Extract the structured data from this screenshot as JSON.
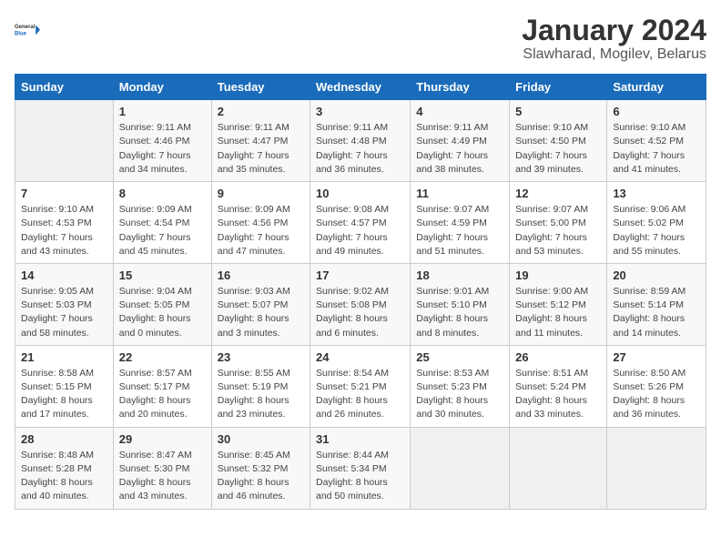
{
  "header": {
    "logo_line1": "General",
    "logo_line2": "Blue",
    "month": "January 2024",
    "location": "Slawharad, Mogilev, Belarus"
  },
  "days_of_week": [
    "Sunday",
    "Monday",
    "Tuesday",
    "Wednesday",
    "Thursday",
    "Friday",
    "Saturday"
  ],
  "weeks": [
    [
      {
        "num": "",
        "info": ""
      },
      {
        "num": "1",
        "info": "Sunrise: 9:11 AM\nSunset: 4:46 PM\nDaylight: 7 hours\nand 34 minutes."
      },
      {
        "num": "2",
        "info": "Sunrise: 9:11 AM\nSunset: 4:47 PM\nDaylight: 7 hours\nand 35 minutes."
      },
      {
        "num": "3",
        "info": "Sunrise: 9:11 AM\nSunset: 4:48 PM\nDaylight: 7 hours\nand 36 minutes."
      },
      {
        "num": "4",
        "info": "Sunrise: 9:11 AM\nSunset: 4:49 PM\nDaylight: 7 hours\nand 38 minutes."
      },
      {
        "num": "5",
        "info": "Sunrise: 9:10 AM\nSunset: 4:50 PM\nDaylight: 7 hours\nand 39 minutes."
      },
      {
        "num": "6",
        "info": "Sunrise: 9:10 AM\nSunset: 4:52 PM\nDaylight: 7 hours\nand 41 minutes."
      }
    ],
    [
      {
        "num": "7",
        "info": "Sunrise: 9:10 AM\nSunset: 4:53 PM\nDaylight: 7 hours\nand 43 minutes."
      },
      {
        "num": "8",
        "info": "Sunrise: 9:09 AM\nSunset: 4:54 PM\nDaylight: 7 hours\nand 45 minutes."
      },
      {
        "num": "9",
        "info": "Sunrise: 9:09 AM\nSunset: 4:56 PM\nDaylight: 7 hours\nand 47 minutes."
      },
      {
        "num": "10",
        "info": "Sunrise: 9:08 AM\nSunset: 4:57 PM\nDaylight: 7 hours\nand 49 minutes."
      },
      {
        "num": "11",
        "info": "Sunrise: 9:07 AM\nSunset: 4:59 PM\nDaylight: 7 hours\nand 51 minutes."
      },
      {
        "num": "12",
        "info": "Sunrise: 9:07 AM\nSunset: 5:00 PM\nDaylight: 7 hours\nand 53 minutes."
      },
      {
        "num": "13",
        "info": "Sunrise: 9:06 AM\nSunset: 5:02 PM\nDaylight: 7 hours\nand 55 minutes."
      }
    ],
    [
      {
        "num": "14",
        "info": "Sunrise: 9:05 AM\nSunset: 5:03 PM\nDaylight: 7 hours\nand 58 minutes."
      },
      {
        "num": "15",
        "info": "Sunrise: 9:04 AM\nSunset: 5:05 PM\nDaylight: 8 hours\nand 0 minutes."
      },
      {
        "num": "16",
        "info": "Sunrise: 9:03 AM\nSunset: 5:07 PM\nDaylight: 8 hours\nand 3 minutes."
      },
      {
        "num": "17",
        "info": "Sunrise: 9:02 AM\nSunset: 5:08 PM\nDaylight: 8 hours\nand 6 minutes."
      },
      {
        "num": "18",
        "info": "Sunrise: 9:01 AM\nSunset: 5:10 PM\nDaylight: 8 hours\nand 8 minutes."
      },
      {
        "num": "19",
        "info": "Sunrise: 9:00 AM\nSunset: 5:12 PM\nDaylight: 8 hours\nand 11 minutes."
      },
      {
        "num": "20",
        "info": "Sunrise: 8:59 AM\nSunset: 5:14 PM\nDaylight: 8 hours\nand 14 minutes."
      }
    ],
    [
      {
        "num": "21",
        "info": "Sunrise: 8:58 AM\nSunset: 5:15 PM\nDaylight: 8 hours\nand 17 minutes."
      },
      {
        "num": "22",
        "info": "Sunrise: 8:57 AM\nSunset: 5:17 PM\nDaylight: 8 hours\nand 20 minutes."
      },
      {
        "num": "23",
        "info": "Sunrise: 8:55 AM\nSunset: 5:19 PM\nDaylight: 8 hours\nand 23 minutes."
      },
      {
        "num": "24",
        "info": "Sunrise: 8:54 AM\nSunset: 5:21 PM\nDaylight: 8 hours\nand 26 minutes."
      },
      {
        "num": "25",
        "info": "Sunrise: 8:53 AM\nSunset: 5:23 PM\nDaylight: 8 hours\nand 30 minutes."
      },
      {
        "num": "26",
        "info": "Sunrise: 8:51 AM\nSunset: 5:24 PM\nDaylight: 8 hours\nand 33 minutes."
      },
      {
        "num": "27",
        "info": "Sunrise: 8:50 AM\nSunset: 5:26 PM\nDaylight: 8 hours\nand 36 minutes."
      }
    ],
    [
      {
        "num": "28",
        "info": "Sunrise: 8:48 AM\nSunset: 5:28 PM\nDaylight: 8 hours\nand 40 minutes."
      },
      {
        "num": "29",
        "info": "Sunrise: 8:47 AM\nSunset: 5:30 PM\nDaylight: 8 hours\nand 43 minutes."
      },
      {
        "num": "30",
        "info": "Sunrise: 8:45 AM\nSunset: 5:32 PM\nDaylight: 8 hours\nand 46 minutes."
      },
      {
        "num": "31",
        "info": "Sunrise: 8:44 AM\nSunset: 5:34 PM\nDaylight: 8 hours\nand 50 minutes."
      },
      {
        "num": "",
        "info": ""
      },
      {
        "num": "",
        "info": ""
      },
      {
        "num": "",
        "info": ""
      }
    ]
  ]
}
